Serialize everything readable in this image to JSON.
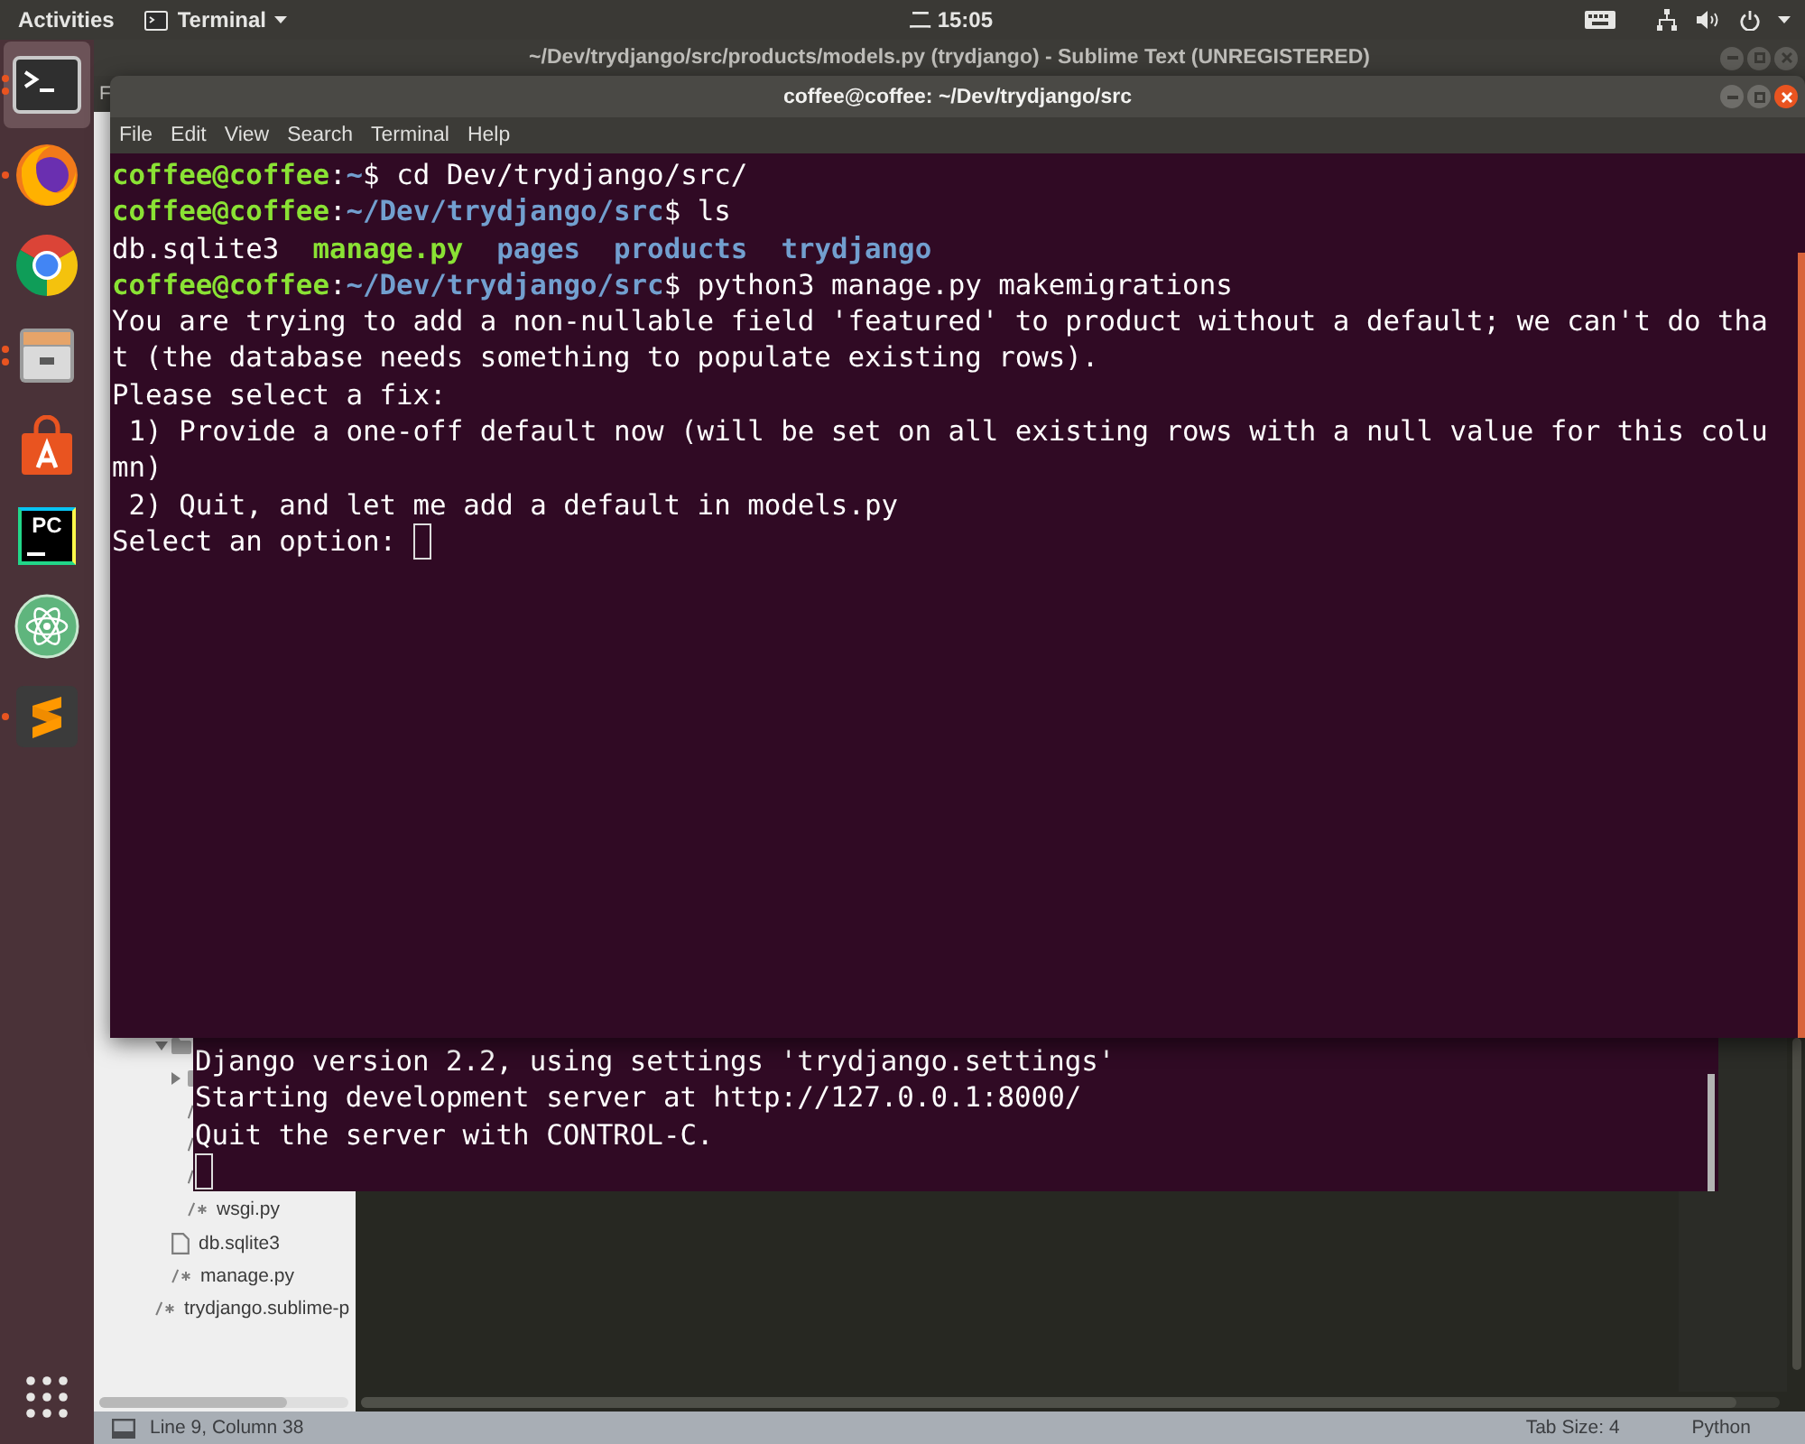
{
  "top_bar": {
    "activities": "Activities",
    "app_menu": "Terminal",
    "clock": "二 15:05"
  },
  "dock": {
    "apps": [
      {
        "kind": "terminal",
        "selected": true,
        "running": true,
        "multiple": true
      },
      {
        "kind": "firefox",
        "selected": false,
        "running": true,
        "multiple": false
      },
      {
        "kind": "chrome",
        "selected": false,
        "running": false,
        "multiple": false
      },
      {
        "kind": "files",
        "selected": false,
        "running": true,
        "multiple": true
      },
      {
        "kind": "software",
        "selected": false,
        "running": false,
        "multiple": false
      },
      {
        "kind": "pycharm",
        "selected": false,
        "running": false,
        "multiple": false,
        "logo_text": "PC"
      },
      {
        "kind": "atom",
        "selected": false,
        "running": false,
        "multiple": false
      },
      {
        "kind": "sublime",
        "selected": false,
        "running": true,
        "multiple": false
      }
    ]
  },
  "sublime": {
    "title": "~/Dev/trydjango/src/products/models.py (trydjango) - Sublime Text (UNREGISTERED)",
    "menu": [
      "F"
    ],
    "sidebar": {
      "items": [
        {
          "kind": "group",
          "children": [
            {
              "kind": "folder",
              "expanded": true,
              "children": [
                {
                  "kind": "folder",
                  "expanded": false
                },
                {
                  "kind": "source"
                },
                {
                  "kind": "source"
                },
                {
                  "kind": "source"
                },
                {
                  "kind": "source",
                  "label": "wsgi.py"
                }
              ]
            },
            {
              "kind": "file",
              "label": "db.sqlite3"
            },
            {
              "kind": "source",
              "label": "manage.py"
            }
          ]
        },
        {
          "kind": "source",
          "label": "trydjango.sublime-p"
        }
      ]
    },
    "status_bar": {
      "position": "Line 9, Column 38",
      "tab_size": "Tab Size: 4",
      "syntax": "Python"
    }
  },
  "server_terminal": {
    "lines": [
      "Django version 2.2, using settings 'trydjango.settings'",
      "Starting development server at http://127.0.0.1:8000/",
      "Quit the server with CONTROL-C."
    ],
    "cursor": true
  },
  "terminal": {
    "title": "coffee@coffee: ~/Dev/trydjango/src",
    "menu": [
      "File",
      "Edit",
      "View",
      "Search",
      "Terminal",
      "Help"
    ],
    "lines": [
      {
        "segments": [
          {
            "kind": "user",
            "text": "coffee@coffee"
          },
          {
            "kind": "plain",
            "text": ":"
          },
          {
            "kind": "path",
            "text": "~"
          },
          {
            "kind": "plain",
            "text": "$ cd Dev/trydjango/src/"
          }
        ]
      },
      {
        "segments": [
          {
            "kind": "user",
            "text": "coffee@coffee"
          },
          {
            "kind": "plain",
            "text": ":"
          },
          {
            "kind": "path",
            "text": "~/Dev/trydjango/src"
          },
          {
            "kind": "plain",
            "text": "$ ls"
          }
        ]
      },
      {
        "segments": [
          {
            "kind": "plain",
            "text": "db.sqlite3  "
          },
          {
            "kind": "exec",
            "text": "manage.py"
          },
          {
            "kind": "dir",
            "text": "  pages"
          },
          {
            "kind": "dir",
            "text": "  products"
          },
          {
            "kind": "dir",
            "text": "  trydjango"
          }
        ]
      },
      {
        "segments": [
          {
            "kind": "user",
            "text": "coffee@coffee"
          },
          {
            "kind": "plain",
            "text": ":"
          },
          {
            "kind": "path",
            "text": "~/Dev/trydjango/src"
          },
          {
            "kind": "plain",
            "text": "$ python3 manage.py makemigrations"
          }
        ]
      },
      {
        "segments": [
          {
            "kind": "plain",
            "text": "You are trying to add a non-nullable field 'featured' to product without a default; we can't do tha"
          }
        ]
      },
      {
        "segments": [
          {
            "kind": "plain",
            "text": "t (the database needs something to populate existing rows)."
          }
        ]
      },
      {
        "segments": [
          {
            "kind": "plain",
            "text": "Please select a fix:"
          }
        ]
      },
      {
        "segments": [
          {
            "kind": "plain",
            "text": " 1) Provide a one-off default now (will be set on all existing rows with a null value for this colu"
          }
        ]
      },
      {
        "segments": [
          {
            "kind": "plain",
            "text": "mn)"
          }
        ]
      },
      {
        "segments": [
          {
            "kind": "plain",
            "text": " 2) Quit, and let me add a default in models.py"
          }
        ]
      },
      {
        "segments": [
          {
            "kind": "plain",
            "text": "Select an option:"
          }
        ]
      }
    ],
    "cursor": true
  }
}
